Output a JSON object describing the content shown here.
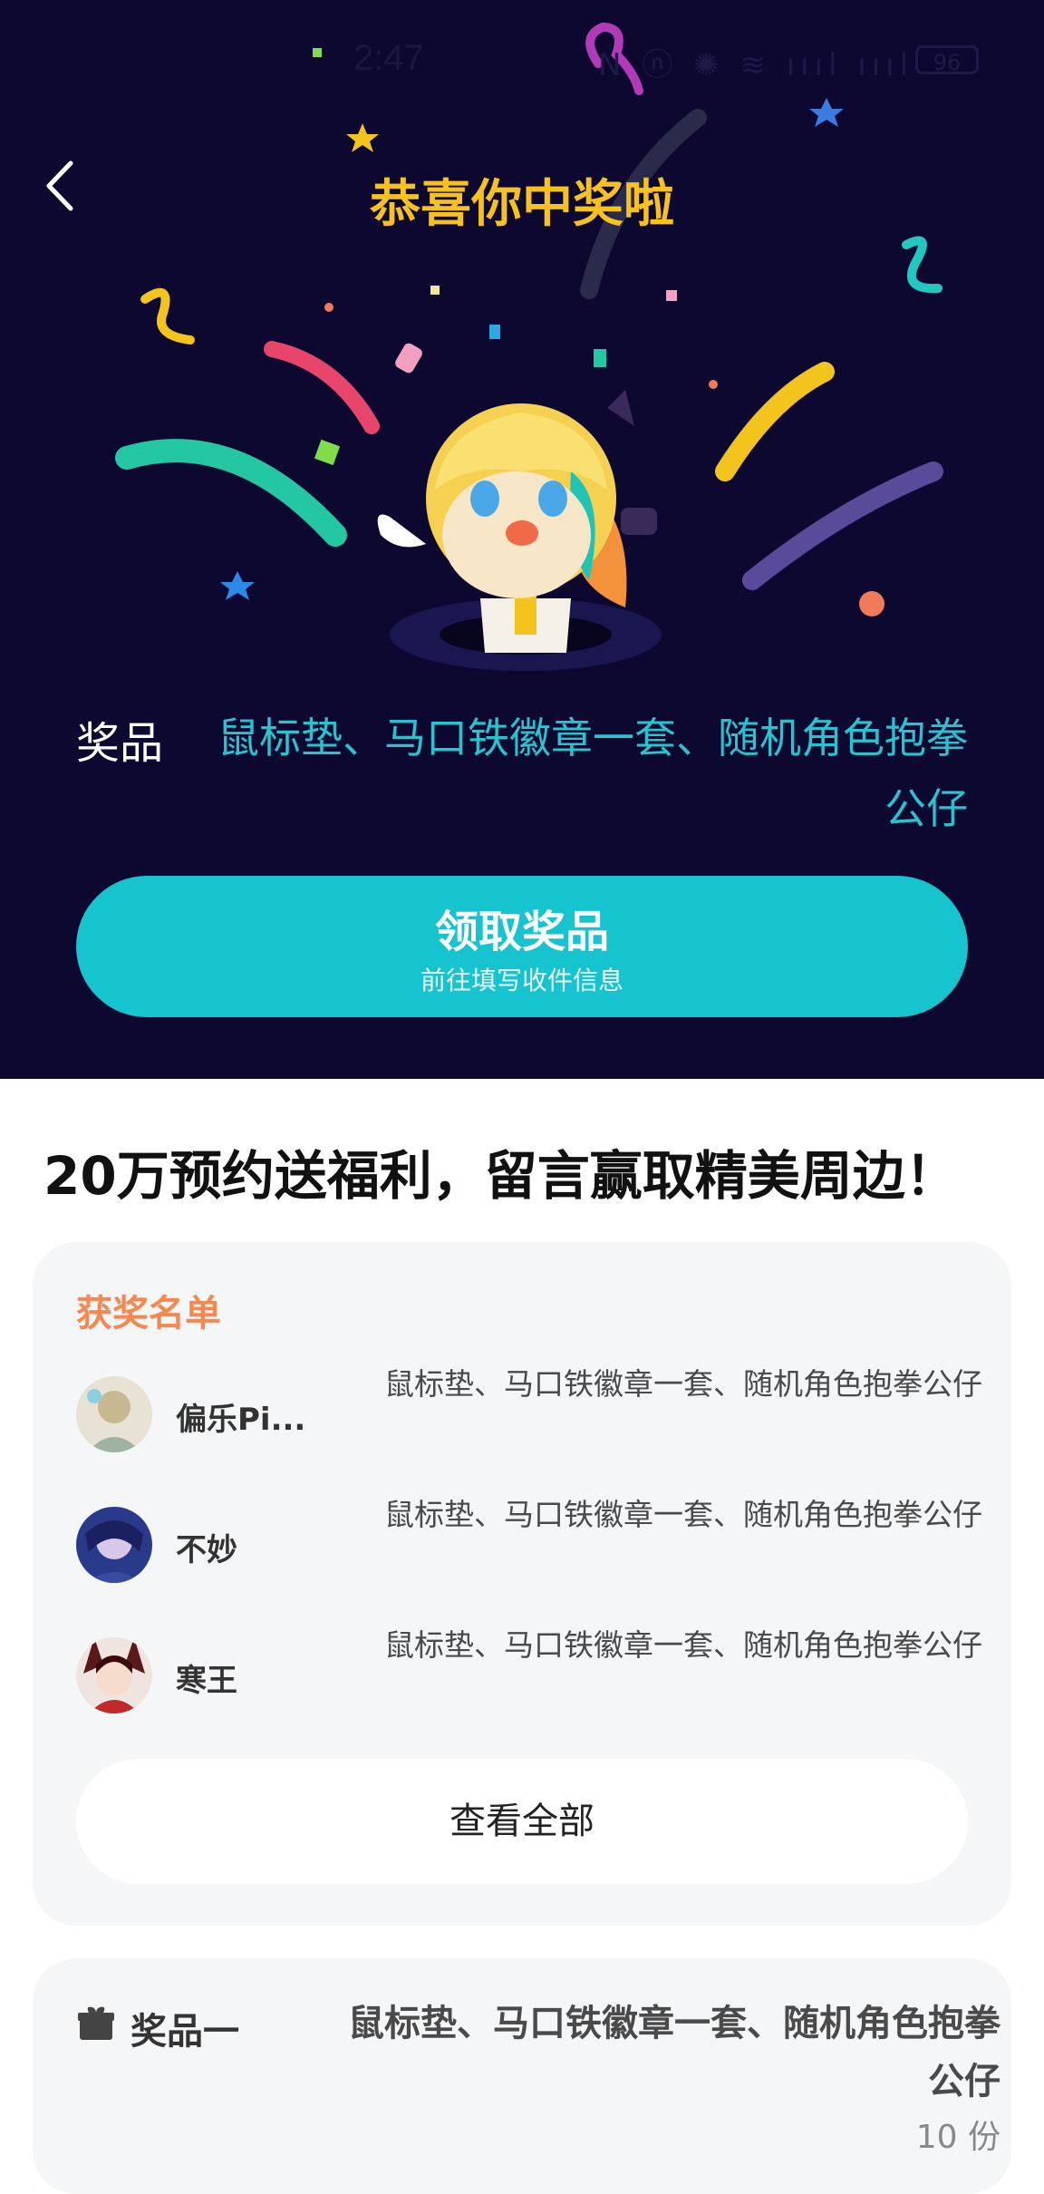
{
  "status_bar": {
    "time": "2:47",
    "icons": "N ⓝ ✺ ≋ ıııl ıııl",
    "battery": "96"
  },
  "header": {
    "title": "恭喜你中奖啦"
  },
  "prize": {
    "label": "奖品",
    "value": "鼠标垫、马口铁徽章一套、随机角色抱拳公仔"
  },
  "claim": {
    "title": "领取奖品",
    "subtitle": "前往填写收件信息"
  },
  "section": {
    "heading": "20万预约送福利，留言赢取精美周边！"
  },
  "winners": {
    "title": "获奖名单",
    "rows": [
      {
        "name": "偏乐Pi...",
        "prize": "鼠标垫、马口铁徽章一套、随机角色抱拳公仔"
      },
      {
        "name": "不妙",
        "prize": "鼠标垫、马口铁徽章一套、随机角色抱拳公仔"
      },
      {
        "name": "寒王",
        "prize": "鼠标垫、马口铁徽章一套、随机角色抱拳公仔"
      }
    ],
    "view_all": "查看全部"
  },
  "prize_tier": {
    "label": "奖品一",
    "desc": "鼠标垫、马口铁徽章一套、随机角色抱拳公仔",
    "quantity": "10 份"
  },
  "colors": {
    "hero_bg": "#0c0830",
    "accent_teal": "#16c4d0",
    "title_yellow": "#f7c21e",
    "winners_orange": "#f5874f"
  },
  "icons": [
    "back-arrow-icon",
    "gift-icon",
    "wifi-icon",
    "signal-icon",
    "battery-icon"
  ]
}
